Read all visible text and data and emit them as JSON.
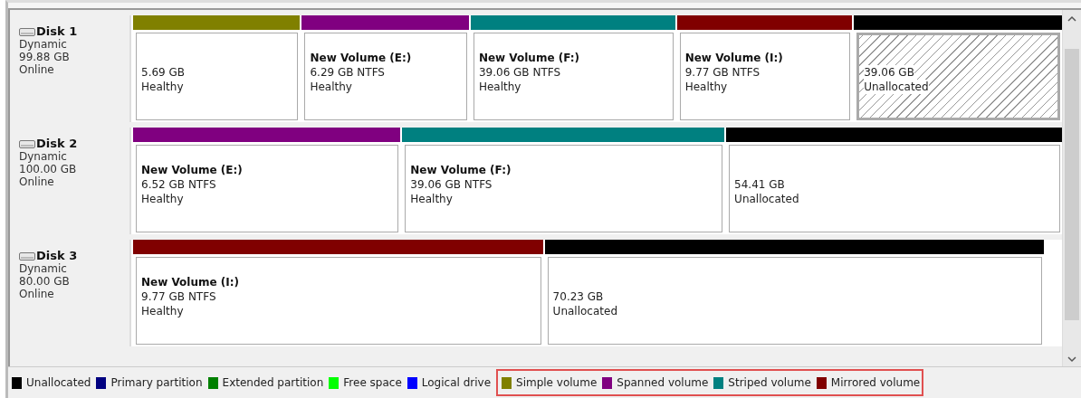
{
  "disks": [
    {
      "name": "Disk 1",
      "type": "Dynamic",
      "capacity": "99.88 GB",
      "status": "Online",
      "partitions": [
        {
          "kind": "simple",
          "size": "5.69 GB",
          "status": "Healthy",
          "selected": false
        },
        {
          "kind": "spanned",
          "name": "New Volume  (E:)",
          "size": "6.29 GB NTFS",
          "status": "Healthy",
          "selected": false
        },
        {
          "kind": "striped",
          "name": "New Volume  (F:)",
          "size": "39.06 GB NTFS",
          "status": "Healthy",
          "selected": false
        },
        {
          "kind": "mirrored",
          "name": "New Volume  (I:)",
          "size": "9.77 GB NTFS",
          "status": "Healthy",
          "selected": false
        },
        {
          "kind": "unallocated",
          "size": "39.06 GB",
          "status": "Unallocated",
          "selected": true
        }
      ]
    },
    {
      "name": "Disk 2",
      "type": "Dynamic",
      "capacity": "100.00 GB",
      "status": "Online",
      "partitions": [
        {
          "kind": "spanned",
          "name": "New Volume  (E:)",
          "size": "6.52 GB NTFS",
          "status": "Healthy",
          "selected": false
        },
        {
          "kind": "striped",
          "name": "New Volume  (F:)",
          "size": "39.06 GB NTFS",
          "status": "Healthy",
          "selected": false
        },
        {
          "kind": "unallocated",
          "size": "54.41 GB",
          "status": "Unallocated",
          "selected": false
        }
      ]
    },
    {
      "name": "Disk 3",
      "type": "Dynamic",
      "capacity": "80.00 GB",
      "status": "Online",
      "partitions": [
        {
          "kind": "mirrored",
          "name": "New Volume  (I:)",
          "size": "9.77 GB NTFS",
          "status": "Healthy",
          "selected": false
        },
        {
          "kind": "unallocated",
          "size": "70.23 GB",
          "status": "Unallocated",
          "selected": false
        }
      ]
    }
  ],
  "legend": [
    {
      "label": "Unallocated",
      "color": "#000000",
      "highlighted": false
    },
    {
      "label": "Primary partition",
      "color": "#000080",
      "highlighted": false
    },
    {
      "label": "Extended partition",
      "color": "#008000",
      "highlighted": false
    },
    {
      "label": "Free space",
      "color": "#00ff00",
      "highlighted": false
    },
    {
      "label": "Logical drive",
      "color": "#0000ff",
      "highlighted": false
    },
    {
      "label": "Simple volume",
      "color": "#808000",
      "highlighted": true
    },
    {
      "label": "Spanned volume",
      "color": "#800080",
      "highlighted": true
    },
    {
      "label": "Striped volume",
      "color": "#008080",
      "highlighted": true
    },
    {
      "label": "Mirrored volume",
      "color": "#800000",
      "highlighted": true
    }
  ]
}
